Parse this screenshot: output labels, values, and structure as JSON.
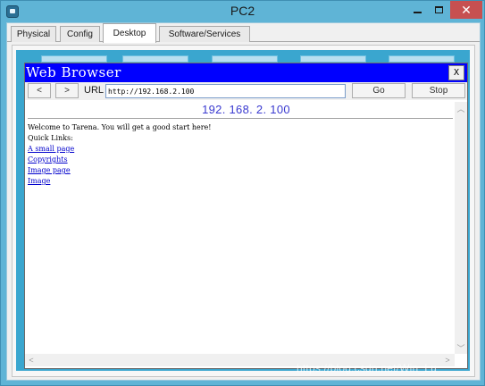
{
  "window": {
    "title": "PC2",
    "minimize_icon": "minimize-icon",
    "maximize_icon": "maximize-icon",
    "close_label": "✕"
  },
  "tabs": [
    {
      "label": "Physical"
    },
    {
      "label": "Config"
    },
    {
      "label": "Desktop",
      "active": true
    },
    {
      "label": "Software/Services"
    }
  ],
  "browser": {
    "title": "Web Browser",
    "close_label": "X",
    "back_label": "<",
    "forward_label": ">",
    "url_label": "URL",
    "url_value": "http://192.168.2.100",
    "go_label": "Go",
    "stop_label": "Stop",
    "page_header": "192. 168. 2. 100",
    "welcome_text": "Welcome to Tarena.  You will get a good start here!",
    "quick_links_label": "Quick Links:",
    "links": [
      {
        "label": "A small page"
      },
      {
        "label": "Copyrights"
      },
      {
        "label": "Image page"
      },
      {
        "label": "Image"
      }
    ]
  },
  "watermark": "https://blog.csdn.net/Win_Lu",
  "colors": {
    "browser_titlebar": "#0000ff",
    "link": "#0000cc",
    "window_frame": "#5fb4d6",
    "close_button": "#c75050"
  }
}
